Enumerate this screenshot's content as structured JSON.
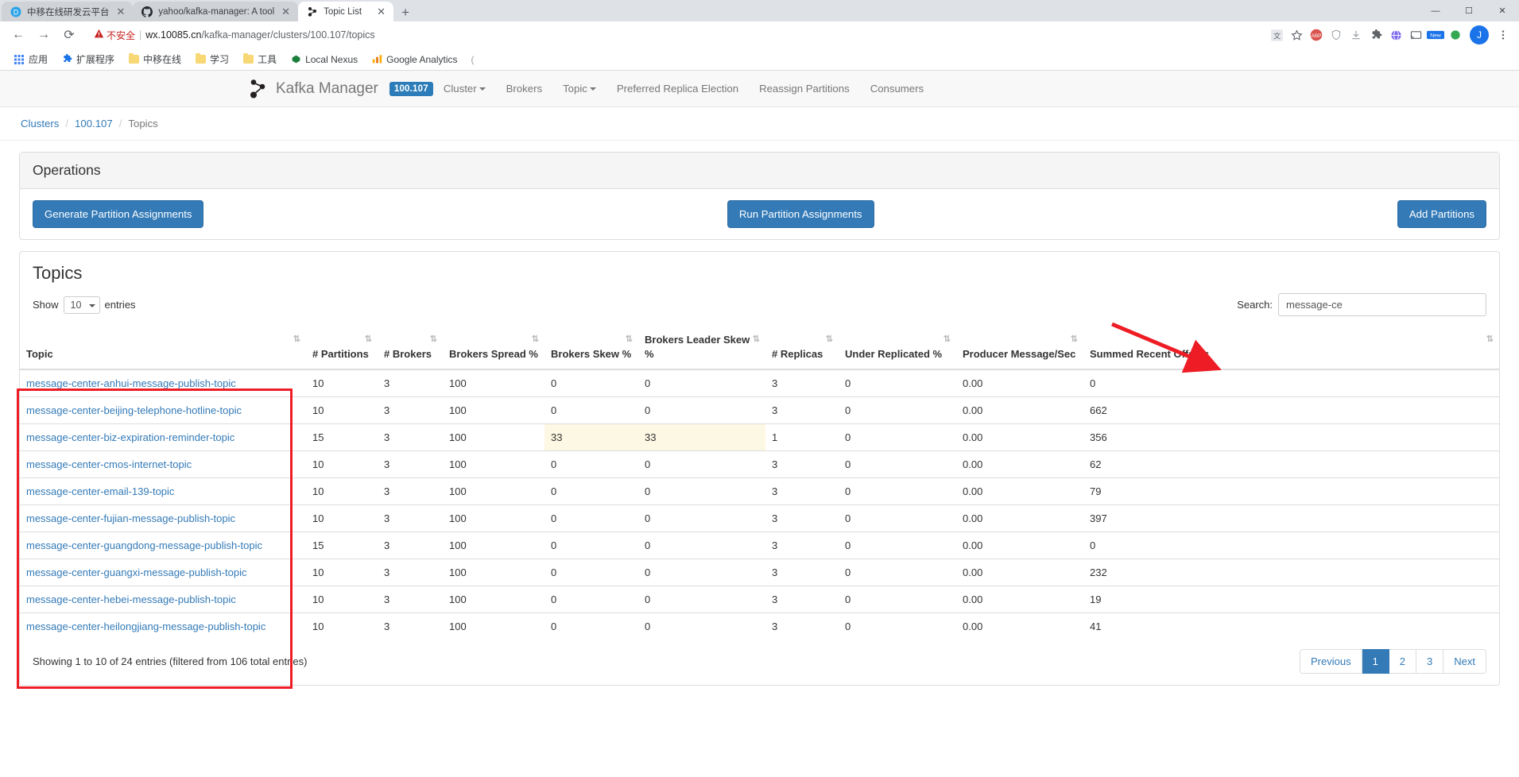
{
  "browser": {
    "tabs": [
      {
        "title": "中移在线研发云平台",
        "favicon": "D",
        "active": false
      },
      {
        "title": "yahoo/kafka-manager: A tool",
        "favicon": "github-icon",
        "active": false
      },
      {
        "title": "Topic List",
        "favicon": "kafka-icon",
        "active": true
      }
    ],
    "new_tab_label": "+",
    "window_controls": {
      "minimize": "—",
      "maximize": "☐",
      "close": "✕"
    },
    "nav": {
      "back": "←",
      "forward": "→",
      "reload": "⟳"
    },
    "omnibox": {
      "security_label": "不安全",
      "security_icon": "warning-triangle-icon",
      "host": "wx.10085.cn",
      "path": "/kafka-manager/clusters/100.107/topics",
      "bookmark_icon": "star-icon",
      "translate_icon": "translate-icon"
    },
    "toolbar_icons": [
      "abp-icon",
      "shield-icon",
      "download-icon",
      "puzzle-icon",
      "globe-icon",
      "cast-icon",
      "new-badge-icon",
      "green-icon"
    ],
    "profile_initial": "J",
    "menu_icon": "three-dots-icon",
    "bookmarks": [
      {
        "label": "应用",
        "icon": "apps-grid-icon"
      },
      {
        "label": "扩展程序",
        "icon": "puzzle-icon"
      },
      {
        "label": "中移在线",
        "icon": "folder-icon"
      },
      {
        "label": "学习",
        "icon": "folder-icon"
      },
      {
        "label": "工具",
        "icon": "folder-icon"
      },
      {
        "label": "Local Nexus",
        "icon": "nexus-icon"
      },
      {
        "label": "Google Analytics",
        "icon": "analytics-icon"
      }
    ]
  },
  "app": {
    "brand": "Kafka Manager",
    "cluster_badge": "100.107",
    "nav_items": [
      {
        "label": "Cluster",
        "has_caret": true
      },
      {
        "label": "Brokers",
        "has_caret": false
      },
      {
        "label": "Topic",
        "has_caret": true
      },
      {
        "label": "Preferred Replica Election",
        "has_caret": false
      },
      {
        "label": "Reassign Partitions",
        "has_caret": false
      },
      {
        "label": "Consumers",
        "has_caret": false
      }
    ],
    "breadcrumb": [
      {
        "label": "Clusters",
        "link": true
      },
      {
        "label": "100.107",
        "link": true
      },
      {
        "label": "Topics",
        "link": false
      }
    ],
    "breadcrumb_separator": "/"
  },
  "operations": {
    "title": "Operations",
    "generate_label": "Generate Partition Assignments",
    "run_label": "Run Partition Assignments",
    "add_label": "Add Partitions"
  },
  "topics": {
    "title": "Topics",
    "show_label": "Show",
    "entries_label": "entries",
    "entries_value": "10",
    "search_label": "Search:",
    "search_value": "message-ce",
    "search_placeholder": "",
    "columns": [
      "Topic",
      "# Partitions",
      "# Brokers",
      "Brokers Spread %",
      "Brokers Skew %",
      "Brokers Leader Skew %",
      "# Replicas",
      "Under Replicated %",
      "Producer Message/Sec",
      "Summed Recent Offsets"
    ],
    "rows": [
      {
        "topic": "message-center-anhui-message-publish-topic",
        "partitions": "10",
        "brokers": "3",
        "spread": "100",
        "skew": "0",
        "leader_skew": "0",
        "replicas": "3",
        "under_replicated": "0",
        "producer_rate": "0.00",
        "offsets": "0",
        "highlight": false
      },
      {
        "topic": "message-center-beijing-telephone-hotline-topic",
        "partitions": "10",
        "brokers": "3",
        "spread": "100",
        "skew": "0",
        "leader_skew": "0",
        "replicas": "3",
        "under_replicated": "0",
        "producer_rate": "0.00",
        "offsets": "662",
        "highlight": false
      },
      {
        "topic": "message-center-biz-expiration-reminder-topic",
        "partitions": "15",
        "brokers": "3",
        "spread": "100",
        "skew": "33",
        "leader_skew": "33",
        "replicas": "1",
        "under_replicated": "0",
        "producer_rate": "0.00",
        "offsets": "356",
        "highlight": true
      },
      {
        "topic": "message-center-cmos-internet-topic",
        "partitions": "10",
        "brokers": "3",
        "spread": "100",
        "skew": "0",
        "leader_skew": "0",
        "replicas": "3",
        "under_replicated": "0",
        "producer_rate": "0.00",
        "offsets": "62",
        "highlight": false
      },
      {
        "topic": "message-center-email-139-topic",
        "partitions": "10",
        "brokers": "3",
        "spread": "100",
        "skew": "0",
        "leader_skew": "0",
        "replicas": "3",
        "under_replicated": "0",
        "producer_rate": "0.00",
        "offsets": "79",
        "highlight": false
      },
      {
        "topic": "message-center-fujian-message-publish-topic",
        "partitions": "10",
        "brokers": "3",
        "spread": "100",
        "skew": "0",
        "leader_skew": "0",
        "replicas": "3",
        "under_replicated": "0",
        "producer_rate": "0.00",
        "offsets": "397",
        "highlight": false
      },
      {
        "topic": "message-center-guangdong-message-publish-topic",
        "partitions": "15",
        "brokers": "3",
        "spread": "100",
        "skew": "0",
        "leader_skew": "0",
        "replicas": "3",
        "under_replicated": "0",
        "producer_rate": "0.00",
        "offsets": "0",
        "highlight": false
      },
      {
        "topic": "message-center-guangxi-message-publish-topic",
        "partitions": "10",
        "brokers": "3",
        "spread": "100",
        "skew": "0",
        "leader_skew": "0",
        "replicas": "3",
        "under_replicated": "0",
        "producer_rate": "0.00",
        "offsets": "232",
        "highlight": false
      },
      {
        "topic": "message-center-hebei-message-publish-topic",
        "partitions": "10",
        "brokers": "3",
        "spread": "100",
        "skew": "0",
        "leader_skew": "0",
        "replicas": "3",
        "under_replicated": "0",
        "producer_rate": "0.00",
        "offsets": "19",
        "highlight": false
      },
      {
        "topic": "message-center-heilongjiang-message-publish-topic",
        "partitions": "10",
        "brokers": "3",
        "spread": "100",
        "skew": "0",
        "leader_skew": "0",
        "replicas": "3",
        "under_replicated": "0",
        "producer_rate": "0.00",
        "offsets": "41",
        "highlight": false
      }
    ],
    "info_text": "Showing 1 to 10 of 24 entries (filtered from 106 total entries)",
    "pagination": {
      "previous": "Previous",
      "pages": [
        "1",
        "2",
        "3"
      ],
      "active_page": "1",
      "next": "Next"
    }
  },
  "annotations": {
    "rect_color": "#ee1c25",
    "arrow_color": "#ee1c25"
  },
  "colors": {
    "primary": "#337ab7",
    "badge": "#2b7cb8",
    "warn_bg": "#fcf8e3",
    "link": "#337ab7"
  }
}
